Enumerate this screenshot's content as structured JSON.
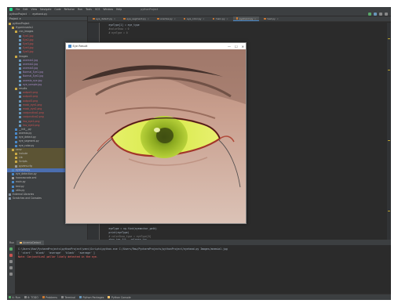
{
  "ide": {
    "menu": [
      "File",
      "Edit",
      "View",
      "Navigate",
      "Code",
      "Refactor",
      "Run",
      "Tools",
      "VCS",
      "Window",
      "Help"
    ],
    "title": "pythonProject"
  },
  "breadcrumbs": [
    "pythonProject",
    "eyehand.py"
  ],
  "project_panel": {
    "title": "Project",
    "root": "pythonProject",
    "items": [
      {
        "label": "pythonProject",
        "type": "folder",
        "color": "#bbbbbb"
      },
      {
        "label": "Hyperinsects1",
        "type": "folder",
        "color": "#bbbbbb"
      },
      {
        "label": "cnn_images",
        "type": "folder",
        "color": "#bbbbbb"
      },
      {
        "label": "Eye1.jpg",
        "type": "image",
        "color": "#d25252"
      },
      {
        "label": "Eye2.jpg",
        "type": "image",
        "color": "#d25252"
      },
      {
        "label": "Eye3.jpg",
        "type": "image",
        "color": "#d25252"
      },
      {
        "label": "Eye4.jpg",
        "type": "image",
        "color": "#d25252"
      },
      {
        "label": "Eye5.jpg",
        "type": "image",
        "color": "#d25252"
      },
      {
        "label": "Images",
        "type": "folder",
        "color": "#bbbbbb"
      },
      {
        "label": "anemia1.jpg",
        "type": "image",
        "color": "#a88cc7"
      },
      {
        "label": "anemia2.jpg",
        "type": "image",
        "color": "#a88cc7"
      },
      {
        "label": "anemia3.jpg",
        "type": "image",
        "color": "#a88cc7"
      },
      {
        "label": "Normal_Eye1.jpg",
        "type": "image",
        "color": "#a88cc7"
      },
      {
        "label": "Normal_Eye2.jpg",
        "type": "image",
        "color": "#a88cc7"
      },
      {
        "label": "anemia_eye.jpg",
        "type": "image",
        "color": "#a88cc7"
      },
      {
        "label": "eye_sample.jpg",
        "type": "image",
        "color": "#a88cc7"
      },
      {
        "label": "results",
        "type": "folder",
        "color": "#bbbbbb"
      },
      {
        "label": "output1.png",
        "type": "image",
        "color": "#d25252"
      },
      {
        "label": "output2.png",
        "type": "image",
        "color": "#d25252"
      },
      {
        "label": "output3.png",
        "type": "image",
        "color": "#d25252"
      },
      {
        "label": "mask_eye1.png",
        "type": "image",
        "color": "#d25252"
      },
      {
        "label": "mask_eye2.png",
        "type": "image",
        "color": "#d25252"
      },
      {
        "label": "conjunctiva1.png",
        "type": "image",
        "color": "#d25252"
      },
      {
        "label": "conjunctiva2.png",
        "type": "image",
        "color": "#d25252"
      },
      {
        "label": "hsv_eye1.png",
        "type": "image",
        "color": "#d25252"
      },
      {
        "label": "hsv_eye2.png",
        "type": "image",
        "color": "#d25252"
      },
      {
        "label": "__init__.py",
        "type": "python",
        "color": "#bbbbbb"
      },
      {
        "label": "anemia.py",
        "type": "python",
        "color": "#bbbbbb"
      },
      {
        "label": "eye_detect.py",
        "type": "python",
        "color": "#bbbbbb"
      },
      {
        "label": "eye_segment.py",
        "type": "python",
        "color": "#bbbbbb"
      },
      {
        "label": "eye_color.py",
        "type": "python",
        "color": "#bbbbbb"
      },
      {
        "label": "venv",
        "type": "folder",
        "color": "#bbbbbb",
        "state": "highlight"
      },
      {
        "label": "include",
        "type": "folder",
        "color": "#bbbbbb",
        "state": "highlight"
      },
      {
        "label": "Lib",
        "type": "folder",
        "color": "#bbbbbb",
        "state": "highlight"
      },
      {
        "label": "Scripts",
        "type": "folder",
        "color": "#bbbbbb",
        "state": "highlight"
      },
      {
        "label": "pyvenv.cfg",
        "type": "file",
        "color": "#bbbbbb",
        "state": "highlight"
      },
      {
        "label": "eyehand.py",
        "type": "python",
        "color": "#bbbbbb",
        "state": "selected"
      },
      {
        "label": "eye_detection.py",
        "type": "python",
        "color": "#bbbbbb"
      },
      {
        "label": "haarcascade.xml",
        "type": "file",
        "color": "#bbbbbb"
      },
      {
        "label": "main.py",
        "type": "python",
        "color": "#bbbbbb"
      },
      {
        "label": "test.py",
        "type": "python",
        "color": "#bbbbbb"
      },
      {
        "label": "utils.py",
        "type": "python",
        "color": "#bbbbbb"
      },
      {
        "label": "External Libraries",
        "type": "library",
        "color": "#bbbbbb"
      },
      {
        "label": "Scratches and Consoles",
        "type": "library",
        "color": "#bbbbbb"
      }
    ]
  },
  "editor_tabs": [
    {
      "label": "eye_detect.py",
      "active": false
    },
    {
      "label": "eye_segment.py",
      "active": false
    },
    {
      "label": "anemia.py",
      "active": false
    },
    {
      "label": "eye_color.py",
      "active": false
    },
    {
      "label": "main.py",
      "active": false
    },
    {
      "label": "eyehand.py",
      "active": true
    },
    {
      "label": "test.py",
      "active": false
    }
  ],
  "code": [
    {
      "text": "    eyeType[1] = eye_type",
      "color": "#a9b7c6"
    },
    {
      "text": "    #colorShow = 0",
      "color": "#808080"
    },
    {
      "text": "    # eyeType = 0",
      "color": "#808080"
    },
    {
      "text": "",
      "color": "#a9b7c6"
    },
    {
      "text": "",
      "color": "#a9b7c6"
    },
    {
      "text": "",
      "color": "#a9b7c6"
    },
    {
      "text": "",
      "color": "#a9b7c6"
    },
    {
      "text": "",
      "color": "#a9b7c6"
    },
    {
      "text": "",
      "color": "#a9b7c6"
    },
    {
      "text": "",
      "color": "#a9b7c6"
    },
    {
      "text": "",
      "color": "#a9b7c6"
    },
    {
      "text": "",
      "color": "#a9b7c6"
    },
    {
      "text": "",
      "color": "#a9b7c6"
    },
    {
      "text": "",
      "color": "#a9b7c6"
    },
    {
      "text": "",
      "color": "#a9b7c6"
    },
    {
      "text": "",
      "color": "#a9b7c6"
    },
    {
      "text": "",
      "color": "#a9b7c6"
    },
    {
      "text": "",
      "color": "#a9b7c6"
    },
    {
      "text": "",
      "color": "#a9b7c6"
    },
    {
      "text": "",
      "color": "#a9b7c6"
    },
    {
      "text": "",
      "color": "#a9b7c6"
    },
    {
      "text": "",
      "color": "#a9b7c6"
    },
    {
      "text": "",
      "color": "#a9b7c6"
    },
    {
      "text": "",
      "color": "#a9b7c6"
    },
    {
      "text": "",
      "color": "#a9b7c6"
    },
    {
      "text": "",
      "color": "#a9b7c6"
    },
    {
      "text": "",
      "color": "#a9b7c6"
    },
    {
      "text": "",
      "color": "#a9b7c6"
    },
    {
      "text": "",
      "color": "#a9b7c6"
    },
    {
      "text": "",
      "color": "#a9b7c6"
    },
    {
      "text": "",
      "color": "#a9b7c6"
    },
    {
      "text": "",
      "color": "#a9b7c6"
    },
    {
      "text": "",
      "color": "#a9b7c6"
    },
    {
      "text": "",
      "color": "#a9b7c6"
    },
    {
      "text": "",
      "color": "#a9b7c6"
    },
    {
      "text": "",
      "color": "#a9b7c6"
    },
    {
      "text": "",
      "color": "#a9b7c6"
    },
    {
      "text": "",
      "color": "#a9b7c6"
    },
    {
      "text": "",
      "color": "#a9b7c6"
    },
    {
      "text": "",
      "color": "#a9b7c6"
    },
    {
      "text": "",
      "color": "#a9b7c6"
    },
    {
      "text": "",
      "color": "#a9b7c6"
    },
    {
      "text": "",
      "color": "#a9b7c6"
    },
    {
      "text": "",
      "color": "#a9b7c6"
    },
    {
      "text": "",
      "color": "#a9b7c6"
    },
    {
      "text": "",
      "color": "#a9b7c6"
    },
    {
      "text": "",
      "color": "#a9b7c6"
    },
    {
      "text": "",
      "color": "#a9b7c6"
    },
    {
      "text": "",
      "color": "#a9b7c6"
    },
    {
      "text": "",
      "color": "#a9b7c6"
    },
    {
      "text": "",
      "color": "#a9b7c6"
    },
    {
      "text": "            cv2.putText(img, str(eye_type), (x, y), font, 0.5, (0, 255, 0), 1)",
      "color": "#a9b7c6"
    },
    {
      "text": "",
      "color": "#a9b7c6"
    },
    {
      "text": "    eyeType = np.find(eyeanchor_path)",
      "color": "#a9b7c6"
    },
    {
      "text": "    print(eyeType)",
      "color": "#a9b7c6"
    },
    {
      "text": "    # colorShow_type = eyeType[0]",
      "color": "#808080"
    },
    {
      "text": "    show_img.fit   release_ipp",
      "color": "#a9b7c6"
    }
  ],
  "run_panel": {
    "label": "Run",
    "tab": "AnemiaDetect",
    "lines": [
      {
        "text": "C:\\Users\\Raw\\PycharmProjects\\pythonProject\\venv\\Scripts\\python.exe C:/Users/Raw/PycharmProjects/pythonProject/eyehand.py Images/anemia1.jpg",
        "color": "#a9b7c6"
      },
      {
        "text": "[ 'start'  'blank'  'average'  'blank'  'average' ]",
        "color": "#a9b7c6"
      },
      {
        "text": "Note: Conjunctival pallor likely detected in the eye.",
        "color": "#ff6b68"
      }
    ]
  },
  "statusbar": [
    {
      "label": "4: Run",
      "icon": "run-icon",
      "color": "#59a869"
    },
    {
      "label": "6: TODO",
      "icon": "todo-icon",
      "color": "#888888"
    },
    {
      "label": "Problems",
      "icon": "problems-icon",
      "color": "#cc7832"
    },
    {
      "label": "Terminal",
      "icon": "terminal-icon",
      "color": "#888888"
    },
    {
      "label": "Python Packages",
      "icon": "packages-icon",
      "color": "#6897bb"
    },
    {
      "label": "Python Console",
      "icon": "console-icon",
      "color": "#ffc66d"
    }
  ],
  "cv_window": {
    "title": "Eye Result",
    "controls": [
      "—",
      "☐",
      "✕"
    ]
  }
}
